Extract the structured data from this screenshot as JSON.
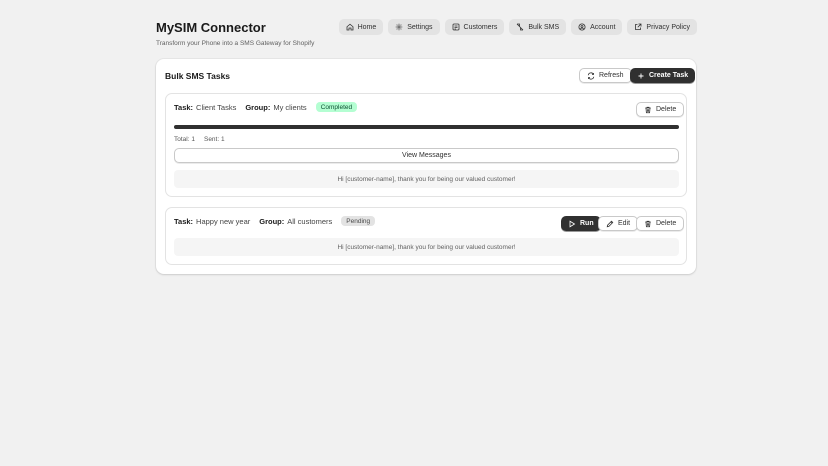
{
  "app": {
    "title": "MySIM Connector",
    "subtitle": "Transform your Phone into a SMS Gateway for Shopify"
  },
  "nav": [
    {
      "label": "Home",
      "icon": "home-icon"
    },
    {
      "label": "Settings",
      "icon": "gear-icon"
    },
    {
      "label": "Customers",
      "icon": "customers-icon"
    },
    {
      "label": "Bulk SMS",
      "icon": "send-icon"
    },
    {
      "label": "Account",
      "icon": "account-icon"
    },
    {
      "label": "Privacy Policy",
      "icon": "external-link-icon"
    }
  ],
  "card": {
    "title": "Bulk SMS Tasks",
    "refresh_label": "Refresh",
    "create_label": "Create Task"
  },
  "labels": {
    "task": "Task:",
    "group": "Group:",
    "total": "Total:",
    "sent": "Sent:"
  },
  "tasks": [
    {
      "name": "Client Tasks",
      "group": "My clients",
      "status": "Completed",
      "status_color": "#b4fed2",
      "status_text_color": "#0c5132",
      "total": "1",
      "sent": "1",
      "progress": 1.0,
      "view_label": "View Messages",
      "delete_label": "Delete",
      "message": "Hi [customer-name], thank you for being our valued customer!"
    },
    {
      "name": "Happy new year",
      "group": "All customers",
      "status": "Pending",
      "status_color": "#e3e3e3",
      "status_text_color": "#4a4a4a",
      "run_label": "Run",
      "edit_label": "Edit",
      "delete_label": "Delete",
      "message": "Hi [customer-name], thank you for being our valued customer!"
    }
  ],
  "colors": {
    "primary": "#303030",
    "background": "#f1f1f1"
  }
}
